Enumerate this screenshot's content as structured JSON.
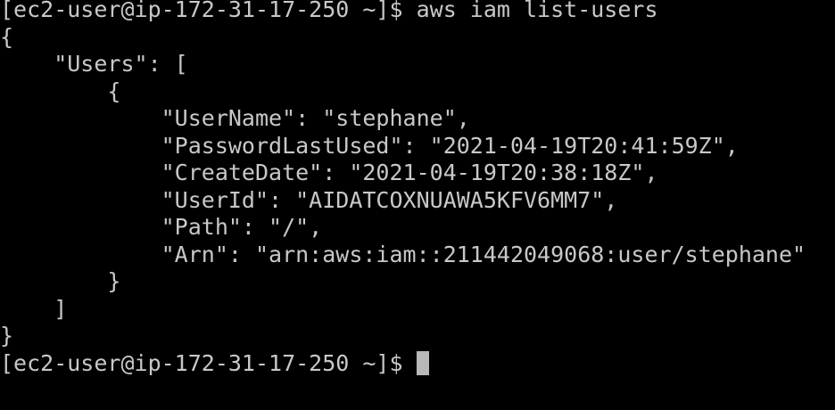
{
  "terminal": {
    "prompt": "[ec2-user@ip-172-31-17-250 ~]$ ",
    "command": "aws iam list-users",
    "output_lines": [
      "{",
      "    \"Users\": [",
      "        {",
      "            \"UserName\": \"stephane\",",
      "            \"PasswordLastUsed\": \"2021-04-19T20:41:59Z\",",
      "            \"CreateDate\": \"2021-04-19T20:38:18Z\",",
      "            \"UserId\": \"AIDATCOXNUAWA5KFV6MM7\",",
      "            \"Path\": \"/\",",
      "            \"Arn\": \"arn:aws:iam::211442049068:user/stephane\"",
      "        }",
      "    ]",
      "}"
    ],
    "final_prompt": "[ec2-user@ip-172-31-17-250 ~]$ "
  }
}
